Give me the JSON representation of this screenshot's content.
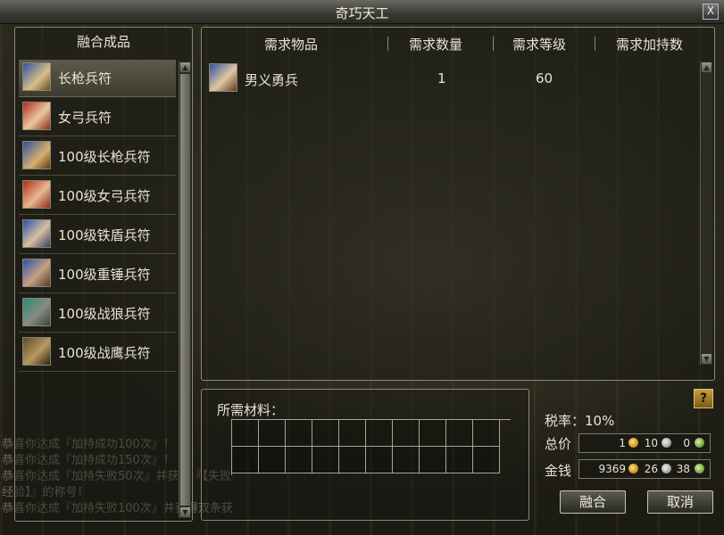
{
  "window": {
    "title": "奇巧天工",
    "close_label": "X"
  },
  "products": {
    "header": "融合成品",
    "items": [
      {
        "label": "长枪兵符",
        "color": "#c0b060"
      },
      {
        "label": "女弓兵符",
        "color": "#c03a2a"
      },
      {
        "label": "100级长枪兵符",
        "color": "#b89850"
      },
      {
        "label": "100级女弓兵符",
        "color": "#c03a2a"
      },
      {
        "label": "100级铁盾兵符",
        "color": "#4a70c0"
      },
      {
        "label": "100级重锤兵符",
        "color": "#4a70c0"
      },
      {
        "label": "100级战狼兵符",
        "color": "#3a9a8a"
      },
      {
        "label": "100级战鹰兵符",
        "color": "#6a5a3a"
      }
    ]
  },
  "requirements": {
    "columns": [
      "需求物品",
      "需求数量",
      "需求等级",
      "需求加持数"
    ],
    "rows": [
      {
        "item": "男义勇兵",
        "quantity": "1",
        "level": "60",
        "bonus": ""
      }
    ]
  },
  "materials": {
    "label": "所需材料："
  },
  "summary": {
    "tax": "税率：10%",
    "total_label": "总价",
    "total": {
      "gold": "1",
      "silver": "10",
      "copper": "0"
    },
    "money_label": "金钱",
    "money": {
      "gold": "9369",
      "silver": "26",
      "copper": "38"
    }
  },
  "actions": {
    "fuse": "融合",
    "cancel": "取消"
  },
  "help": "?",
  "chat": [
    "恭喜你达成『加持成功100次』！",
    "恭喜你达成『加持成功150次』！",
    "恭喜你达成『加持失败50次』并获得『【失败",
    "经验】』的称号！",
    "恭喜你达成『加持失败100次』并获得双条获"
  ]
}
